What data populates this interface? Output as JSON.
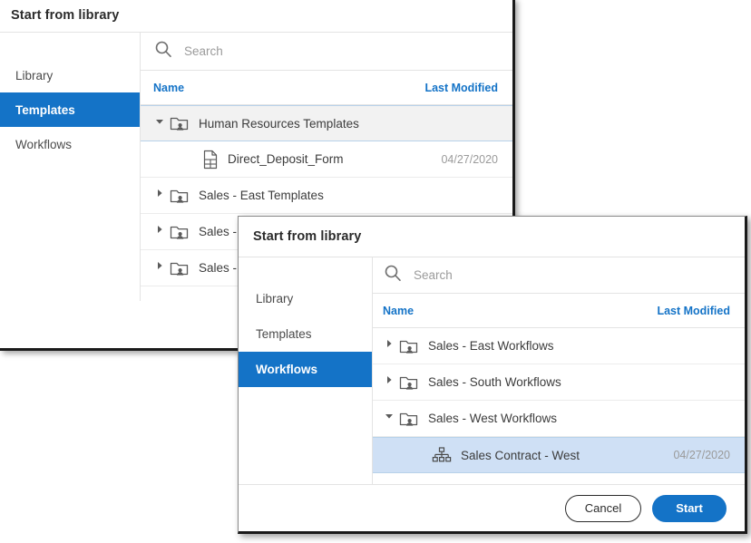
{
  "colors": {
    "accent": "#1473c7",
    "selected_row": "#cfe0f5",
    "hover_row": "#f2f2f2",
    "header_link": "#1473c7",
    "body_text": "#3c3c3c",
    "muted_text": "#9a9a9a"
  },
  "dialog_one": {
    "title": "Start from library",
    "sidebar": {
      "items": [
        {
          "label": "Library",
          "selected": false
        },
        {
          "label": "Templates",
          "selected": true
        },
        {
          "label": "Workflows",
          "selected": false
        }
      ]
    },
    "search": {
      "icon": "search-icon",
      "placeholder": "Search",
      "value": ""
    },
    "columns": {
      "name": "Name",
      "last_modified": "Last Modified"
    },
    "rows": [
      {
        "label": "Human Resources Templates",
        "date": "",
        "icon": "shared-folder-icon",
        "twisty": "expanded",
        "depth": 0,
        "state": "hovered"
      },
      {
        "label": "Direct_Deposit_Form",
        "date": "04/27/2020",
        "icon": "document-icon",
        "twisty": "none",
        "depth": 1,
        "state": "normal"
      },
      {
        "label": "Sales - East Templates",
        "date": "",
        "icon": "shared-folder-icon",
        "twisty": "collapsed",
        "depth": 0,
        "state": "normal"
      },
      {
        "label": "Sales - South Templates",
        "date": "",
        "icon": "shared-folder-icon",
        "twisty": "collapsed",
        "depth": 0,
        "state": "normal"
      },
      {
        "label": "Sales - West Templates",
        "date": "",
        "icon": "shared-folder-icon",
        "twisty": "collapsed",
        "depth": 0,
        "state": "normal"
      }
    ]
  },
  "dialog_two": {
    "title": "Start from library",
    "sidebar": {
      "items": [
        {
          "label": "Library",
          "selected": false
        },
        {
          "label": "Templates",
          "selected": false
        },
        {
          "label": "Workflows",
          "selected": true
        }
      ]
    },
    "search": {
      "icon": "search-icon",
      "placeholder": "Search",
      "value": ""
    },
    "columns": {
      "name": "Name",
      "last_modified": "Last Modified"
    },
    "rows": [
      {
        "label": "Sales - East Workflows",
        "date": "",
        "icon": "shared-folder-icon",
        "twisty": "collapsed",
        "depth": 0,
        "state": "normal"
      },
      {
        "label": "Sales - South Workflows",
        "date": "",
        "icon": "shared-folder-icon",
        "twisty": "collapsed",
        "depth": 0,
        "state": "normal"
      },
      {
        "label": "Sales - West Workflows",
        "date": "",
        "icon": "shared-folder-icon",
        "twisty": "expanded",
        "depth": 0,
        "state": "normal"
      },
      {
        "label": "Sales Contract - West",
        "date": "04/27/2020",
        "icon": "workflow-icon",
        "twisty": "none",
        "depth": 1,
        "state": "selected"
      }
    ],
    "footer": {
      "cancel_label": "Cancel",
      "start_label": "Start"
    }
  }
}
